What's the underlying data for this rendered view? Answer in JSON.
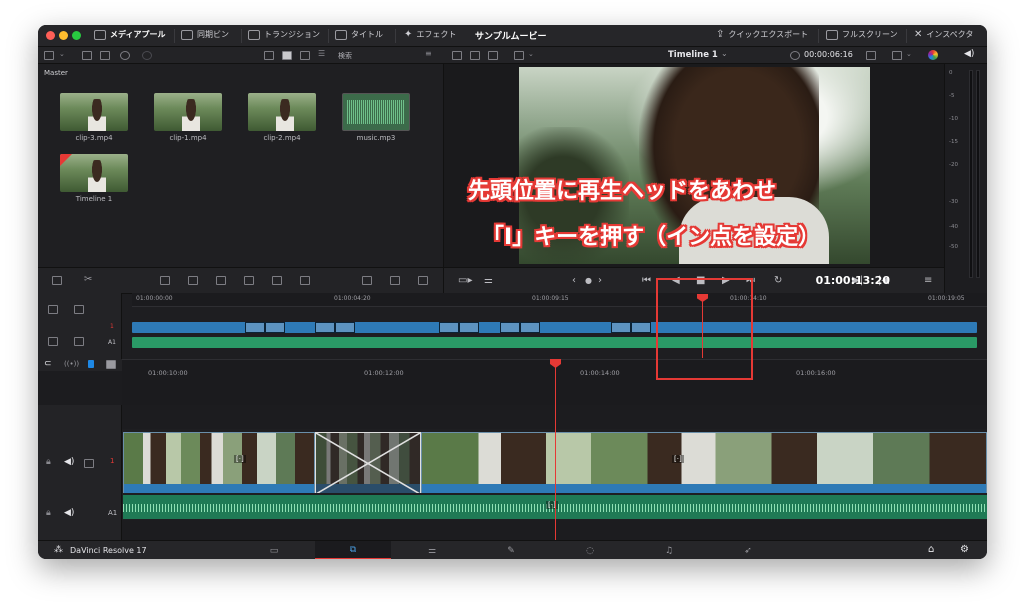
{
  "topbar": {
    "media_pool": "メディアプール",
    "sync_bin": "同期ビン",
    "transitions": "トランジション",
    "titles": "タイトル",
    "effects": "エフェクト",
    "project_title": "サンプルムービー",
    "quick_export": "クイックエクスポート",
    "fullscreen": "フルスクリーン",
    "inspector": "インスペクタ"
  },
  "media": {
    "search_placeholder": "検索",
    "bin": "Master",
    "clips": [
      {
        "name": "clip-3.mp4",
        "kind": "video"
      },
      {
        "name": "clip-1.mp4",
        "kind": "video"
      },
      {
        "name": "clip-2.mp4",
        "kind": "video"
      },
      {
        "name": "music.mp3",
        "kind": "audio"
      },
      {
        "name": "Timeline 1",
        "kind": "timeline"
      }
    ]
  },
  "viewer": {
    "timeline_name": "Timeline 1",
    "duration_tc": "00:00:06:16",
    "current_tc": "01:00:13:20"
  },
  "meters": {
    "ticks": [
      "0",
      "-5",
      "-10",
      "-15",
      "-20",
      "-30",
      "-40",
      "-50"
    ]
  },
  "upper_ruler": [
    "01:00:00:00",
    "01:00:04:20",
    "01:00:09:15",
    "01:00:14:10",
    "01:00:19:05"
  ],
  "lower_ruler": [
    "01:00:10:00",
    "01:00:12:00",
    "01:00:14:00",
    "01:00:16:00"
  ],
  "tracks": {
    "video_label": "1",
    "audio_label": "A1",
    "upper_video": "1",
    "upper_audio": "A1"
  },
  "app": {
    "name": "DaVinci Resolve 17"
  },
  "overlay": {
    "line1": "先頭位置に再生ヘッドをあわせ",
    "line2": "「I」キーを押す（イン点を設定）"
  },
  "colors": {
    "accent": "#e53935",
    "video_track": "#2e7ab6",
    "audio_track": "#2a9a66"
  }
}
